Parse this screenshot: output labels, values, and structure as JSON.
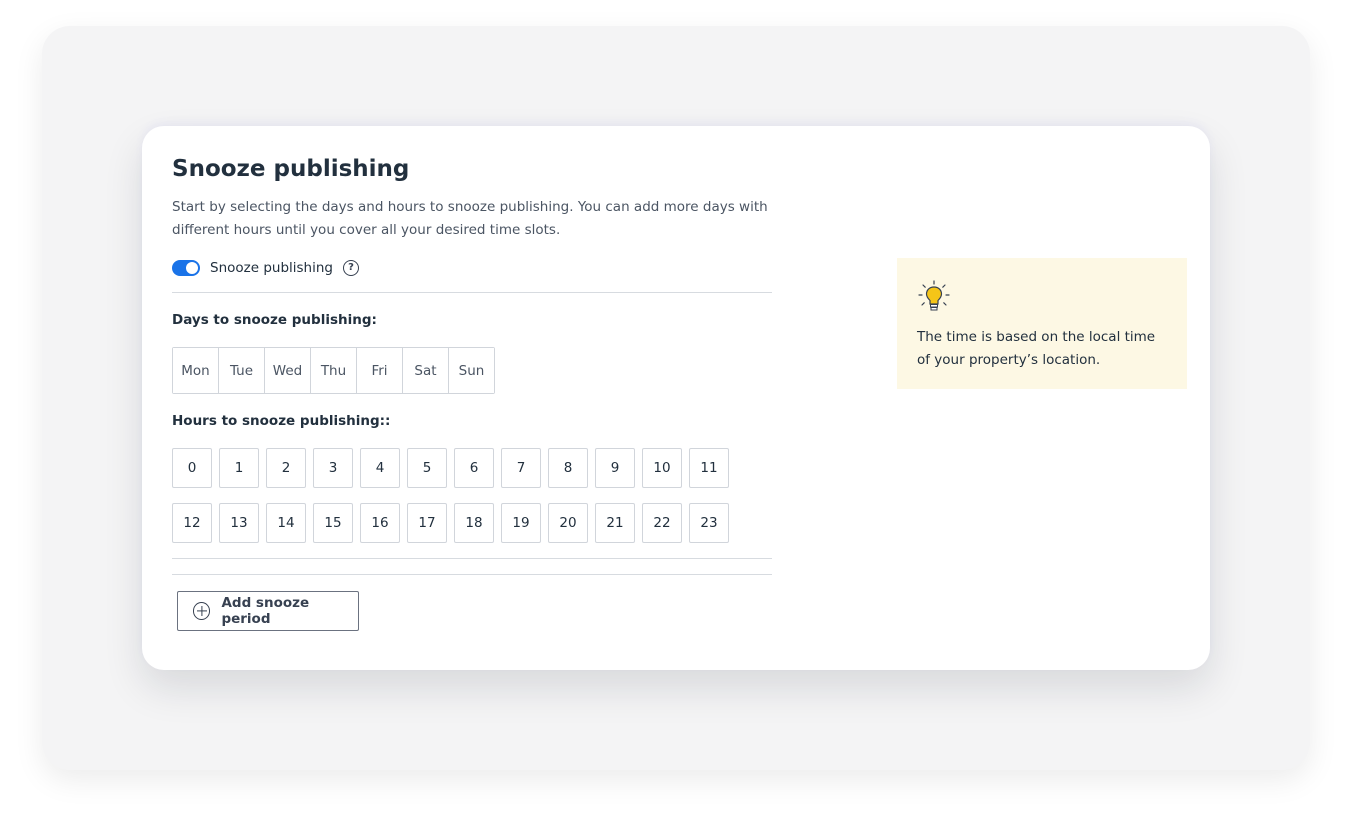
{
  "panel": {
    "title": "Snooze publishing",
    "description": "Start by selecting the days and hours to snooze publishing. You can add more days with different hours until you cover all your desired time slots.",
    "toggle": {
      "label": "Snooze publishing",
      "enabled": true,
      "help": "?"
    },
    "days_label": "Days to snooze publishing:",
    "days": [
      "Mon",
      "Tue",
      "Wed",
      "Thu",
      "Fri",
      "Sat",
      "Sun"
    ],
    "hours_label": "Hours to snooze publishing::",
    "hours_row1": [
      "0",
      "1",
      "2",
      "3",
      "4",
      "5",
      "6",
      "7",
      "8",
      "9",
      "10",
      "11"
    ],
    "hours_row2": [
      "12",
      "13",
      "14",
      "15",
      "16",
      "17",
      "18",
      "19",
      "20",
      "21",
      "22",
      "23"
    ],
    "add_button_label": "Add snooze period"
  },
  "tip": {
    "icon": "lightbulb-icon",
    "text": "The time is based on the local time of your property’s location."
  },
  "colors": {
    "accent": "#1a73e8",
    "tip_background": "#fdf8e4",
    "bulb": "#f5c518"
  }
}
